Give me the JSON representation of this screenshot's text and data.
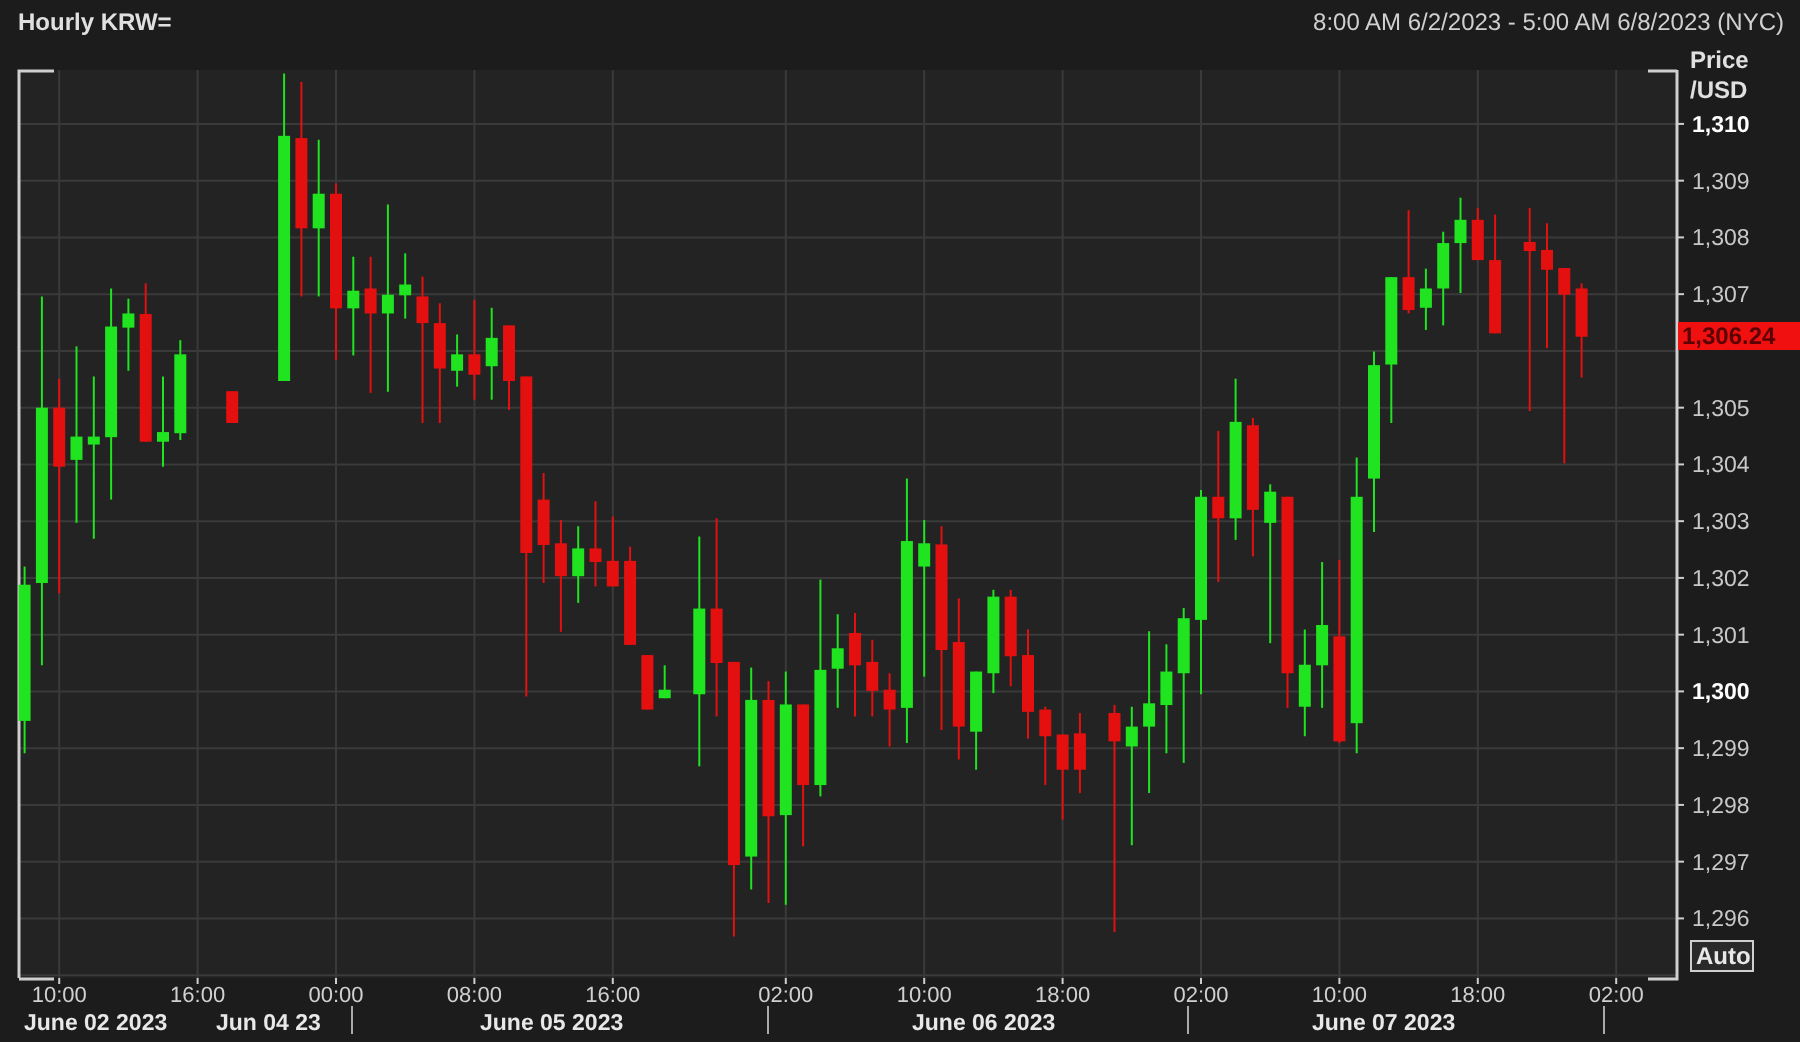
{
  "title": "Hourly KRW=",
  "range": "8:00 AM 6/2/2023 - 5:00 AM 6/8/2023 (NYC)",
  "chart_data": {
    "type": "candlestick",
    "ylabel": "Price /USD",
    "ylim": [
      1294.95,
      1310.95
    ],
    "categories": [
      null,
      null,
      "10:00",
      null,
      null,
      null,
      null,
      null,
      null,
      null,
      "16:00",
      null,
      null,
      null,
      null,
      null,
      null,
      null,
      "00:00",
      null,
      null,
      null,
      null,
      null,
      null,
      null,
      "08:00",
      null,
      null,
      null,
      null,
      null,
      null,
      null,
      "16:00",
      null,
      null,
      null,
      null,
      null,
      null,
      null,
      null,
      null,
      "02:00",
      null,
      null,
      null,
      null,
      null,
      null,
      null,
      "10:00",
      null,
      null,
      null,
      null,
      null,
      null,
      null,
      "18:00",
      null,
      null,
      null,
      null,
      null,
      null,
      null,
      "02:00",
      null,
      null,
      null,
      null,
      null,
      null,
      null,
      "10:00",
      null,
      null,
      null,
      null,
      null,
      null,
      null,
      "18:00",
      null,
      null,
      null,
      null,
      null,
      null,
      null,
      "02:00"
    ],
    "ohlc": [
      [
        1299.48,
        1302.2,
        1298.91,
        1301.88
      ],
      [
        1301.91,
        1306.96,
        1300.46,
        1305.0
      ],
      [
        1305.0,
        1305.51,
        1301.73,
        1303.96
      ],
      [
        1304.08,
        1306.08,
        1302.97,
        1304.49
      ],
      [
        1304.35,
        1305.55,
        1302.69,
        1304.49
      ],
      [
        1304.48,
        1307.1,
        1303.38,
        1306.43
      ],
      [
        1306.41,
        1306.92,
        1305.65,
        1306.66
      ],
      [
        1306.65,
        1307.19,
        1304.4,
        1304.4
      ],
      [
        1304.4,
        1305.55,
        1303.96,
        1304.57
      ],
      [
        1304.55,
        1306.19,
        1304.43,
        1305.94
      ],
      null,
      null,
      [
        1305.29,
        1305.29,
        1304.73,
        1304.73
      ],
      null,
      null,
      [
        1305.47,
        1310.89,
        1305.47,
        1309.79
      ],
      [
        1309.75,
        1310.74,
        1306.96,
        1308.16
      ],
      [
        1308.16,
        1309.72,
        1306.96,
        1308.77
      ],
      [
        1308.77,
        1308.95,
        1305.84,
        1306.75
      ],
      [
        1306.75,
        1307.66,
        1305.92,
        1307.06
      ],
      [
        1307.1,
        1307.66,
        1305.26,
        1306.66
      ],
      [
        1306.66,
        1308.58,
        1305.28,
        1306.99
      ],
      [
        1306.98,
        1307.72,
        1306.57,
        1307.17
      ],
      [
        1306.96,
        1307.31,
        1304.73,
        1306.49
      ],
      [
        1306.49,
        1306.84,
        1304.73,
        1305.69
      ],
      [
        1305.65,
        1306.29,
        1305.37,
        1305.94
      ],
      [
        1305.94,
        1306.9,
        1305.14,
        1305.58
      ],
      [
        1305.73,
        1306.76,
        1305.14,
        1306.23
      ],
      [
        1306.45,
        1306.45,
        1304.96,
        1305.47
      ],
      [
        1305.55,
        1305.55,
        1299.91,
        1302.44
      ],
      [
        1303.38,
        1303.85,
        1301.91,
        1302.58
      ],
      [
        1302.61,
        1303.02,
        1301.05,
        1302.03
      ],
      [
        1302.03,
        1302.91,
        1301.56,
        1302.52
      ],
      [
        1302.52,
        1303.35,
        1301.85,
        1302.28
      ],
      [
        1302.3,
        1303.08,
        1301.85,
        1301.85
      ],
      [
        1302.3,
        1302.55,
        1300.82,
        1300.82
      ],
      [
        1300.64,
        1300.64,
        1299.68,
        1299.68
      ],
      [
        1299.88,
        1300.46,
        1299.88,
        1300.03
      ],
      null,
      [
        1299.95,
        1302.73,
        1298.68,
        1301.46
      ],
      [
        1301.46,
        1303.05,
        1299.56,
        1300.5
      ],
      [
        1300.52,
        1300.52,
        1295.68,
        1296.94
      ],
      [
        1297.09,
        1300.42,
        1296.51,
        1299.85
      ],
      [
        1299.85,
        1300.18,
        1296.27,
        1297.8
      ],
      [
        1297.82,
        1300.35,
        1296.24,
        1299.77
      ],
      [
        1299.77,
        1299.77,
        1297.27,
        1298.35
      ],
      [
        1298.35,
        1301.97,
        1298.15,
        1300.38
      ],
      [
        1300.4,
        1301.36,
        1299.71,
        1300.76
      ],
      [
        1301.03,
        1301.38,
        1299.56,
        1300.46
      ],
      [
        1300.52,
        1300.91,
        1299.56,
        1300.01
      ],
      [
        1300.03,
        1300.32,
        1299.03,
        1299.68
      ],
      [
        1299.71,
        1303.75,
        1299.09,
        1302.65
      ],
      [
        1302.2,
        1303.02,
        1300.26,
        1302.61
      ],
      [
        1302.59,
        1302.91,
        1299.32,
        1300.73
      ],
      [
        1300.87,
        1301.64,
        1298.8,
        1299.38
      ],
      [
        1299.29,
        1300.35,
        1298.62,
        1300.35
      ],
      [
        1300.32,
        1301.79,
        1299.97,
        1301.67
      ],
      [
        1301.67,
        1301.79,
        1300.09,
        1300.62
      ],
      [
        1300.64,
        1301.09,
        1299.17,
        1299.64
      ],
      [
        1299.68,
        1299.73,
        1298.35,
        1299.21
      ],
      [
        1299.24,
        1299.24,
        1297.74,
        1298.62
      ],
      [
        1299.26,
        1299.62,
        1298.21,
        1298.62
      ],
      null,
      [
        1299.62,
        1299.76,
        1295.76,
        1299.12
      ],
      [
        1299.03,
        1299.73,
        1297.29,
        1299.38
      ],
      [
        1299.38,
        1301.06,
        1298.21,
        1299.79
      ],
      [
        1299.76,
        1300.83,
        1298.91,
        1300.35
      ],
      [
        1300.32,
        1301.47,
        1298.74,
        1301.29
      ],
      [
        1301.26,
        1303.55,
        1299.95,
        1303.43
      ],
      [
        1303.43,
        1304.59,
        1301.93,
        1303.05
      ],
      [
        1303.05,
        1305.51,
        1302.67,
        1304.75
      ],
      [
        1304.69,
        1304.82,
        1302.38,
        1303.2
      ],
      [
        1302.97,
        1303.65,
        1300.85,
        1303.52
      ],
      [
        1303.43,
        1303.43,
        1299.71,
        1300.32
      ],
      [
        1299.73,
        1301.09,
        1299.21,
        1300.47
      ],
      [
        1300.46,
        1302.28,
        1299.71,
        1301.17
      ],
      [
        1300.97,
        1302.32,
        1299.09,
        1299.12
      ],
      [
        1299.44,
        1304.12,
        1298.91,
        1303.43
      ],
      [
        1303.75,
        1305.99,
        1302.81,
        1305.75
      ],
      [
        1305.76,
        1307.3,
        1304.73,
        1307.3
      ],
      [
        1307.3,
        1308.48,
        1306.66,
        1306.72
      ],
      [
        1306.76,
        1307.45,
        1306.37,
        1307.1
      ],
      [
        1307.1,
        1308.1,
        1306.45,
        1307.9
      ],
      [
        1307.9,
        1308.7,
        1307.02,
        1308.31
      ],
      [
        1308.31,
        1308.52,
        1307.6,
        1307.6
      ],
      [
        1307.6,
        1308.4,
        1306.31,
        1306.31
      ],
      null,
      [
        1307.92,
        1308.52,
        1304.94,
        1307.76
      ],
      [
        1307.78,
        1308.25,
        1306.05,
        1307.43
      ],
      [
        1307.46,
        1307.46,
        1304.02,
        1306.99
      ],
      [
        1307.1,
        1307.19,
        1305.53,
        1306.25
      ],
      null,
      null
    ],
    "grid": true,
    "yticks": [
      {
        "value": 1310,
        "label": "1,310"
      },
      {
        "value": 1309,
        "label": "1,309"
      },
      {
        "value": 1308,
        "label": "1,308"
      },
      {
        "value": 1307,
        "label": "1,307"
      },
      {
        "value": 1305,
        "label": "1,305"
      },
      {
        "value": 1304,
        "label": "1,304"
      },
      {
        "value": 1303,
        "label": "1,303"
      },
      {
        "value": 1302,
        "label": "1,302"
      },
      {
        "value": 1301,
        "label": "1,301"
      },
      {
        "value": 1300,
        "label": "1,300"
      },
      {
        "value": 1299,
        "label": "1,299"
      },
      {
        "value": 1298,
        "label": "1,298"
      },
      {
        "value": 1297,
        "label": "1,297"
      },
      {
        "value": 1296,
        "label": "1,296"
      }
    ]
  },
  "price_axis": {
    "tick_styles": [
      {
        "bold": true
      },
      {
        "bold": false
      },
      {
        "bold": false
      },
      {
        "bold": false
      },
      {
        "bold": false
      },
      {
        "bold": false
      },
      {
        "bold": false
      },
      {
        "bold": false
      },
      {
        "bold": false
      },
      {
        "bold": true
      },
      {
        "bold": false
      },
      {
        "bold": false
      },
      {
        "bold": false
      },
      {
        "bold": false
      }
    ],
    "last_price": "1,306.24",
    "scale_button": "Auto"
  },
  "dates": [
    "June 02 2023",
    "Jun 04 23",
    "June 05 2023",
    "June 06 2023",
    "June 07 2023"
  ]
}
